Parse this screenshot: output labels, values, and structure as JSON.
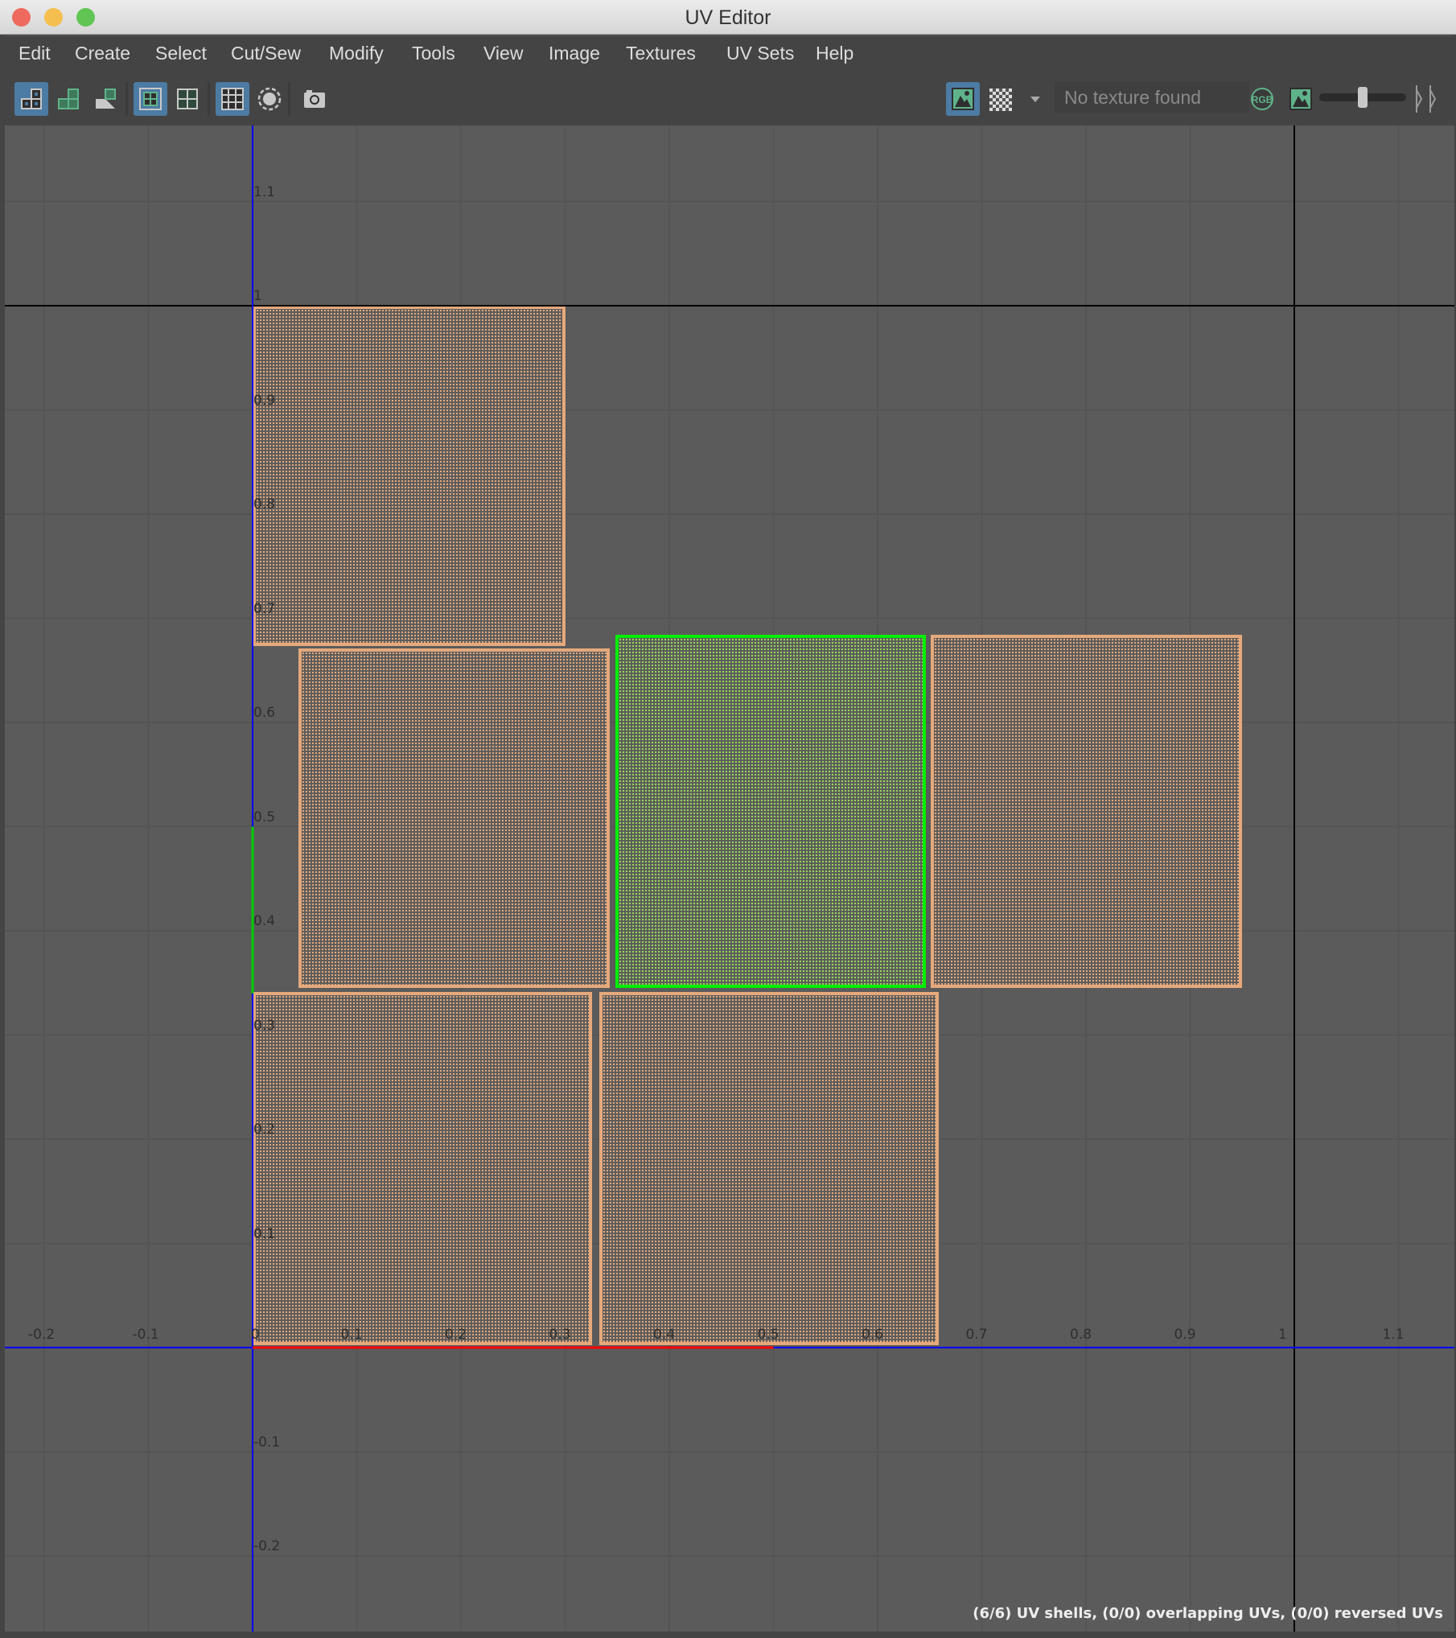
{
  "window": {
    "title": "UV Editor",
    "traffic_lights": [
      "#ee6a5e",
      "#f5bf4f",
      "#61c554"
    ]
  },
  "menu": [
    "Edit",
    "Create",
    "Select",
    "Cut/Sew",
    "Modify",
    "Tools",
    "View",
    "Image",
    "Textures",
    "UV Sets",
    "Help"
  ],
  "toolbar": {
    "left_icons": [
      {
        "name": "uv-shell-layout-icon",
        "active": true
      },
      {
        "name": "uv-shell-green-icon",
        "active": false
      },
      {
        "name": "uv-shell-partial-icon",
        "active": false
      },
      {
        "name": "wireframe-grid-icon",
        "active": true
      },
      {
        "name": "uv-grid-icon",
        "active": false
      },
      {
        "name": "dense-grid-icon",
        "active": true
      },
      {
        "name": "soft-select-circle-icon",
        "active": false
      },
      {
        "name": "camera-snapshot-icon",
        "active": false
      }
    ],
    "texture_field": "No texture found",
    "rgb_label": "RGB",
    "image_display_active": true,
    "slider_value": 0.5
  },
  "viewport": {
    "u_ticks": [
      "-0.2",
      "-0.1",
      "0",
      "0.1",
      "0.2",
      "0.3",
      "0.4",
      "0.5",
      "0.6",
      "0.7",
      "0.8",
      "0.9",
      "1",
      "1.1"
    ],
    "v_ticks": [
      "-0.2",
      "-0.1",
      "0",
      "0.1",
      "0.2",
      "0.3",
      "0.4",
      "0.5",
      "0.6",
      "0.7",
      "0.8",
      "0.9",
      "1",
      "1.1"
    ],
    "colors": {
      "grid": "#545454",
      "axis": "#0000ff",
      "u_highlight": "#ff0000",
      "v_highlight": "#00cc00",
      "unit_boundary": "#000000",
      "shell": "#e5a97c",
      "selected_shell": "#00ee00"
    },
    "shells": [
      {
        "u": [
          0.0,
          0.3
        ],
        "v": [
          0.673,
          1.0
        ],
        "selected": false
      },
      {
        "u": [
          0.044,
          0.343
        ],
        "v": [
          0.345,
          0.671
        ],
        "selected": false
      },
      {
        "u": [
          0.348,
          0.646
        ],
        "v": [
          0.345,
          0.684
        ],
        "selected": true
      },
      {
        "u": [
          0.651,
          0.95
        ],
        "v": [
          0.345,
          0.684
        ],
        "selected": false
      },
      {
        "u": [
          0.0,
          0.326
        ],
        "v": [
          0.002,
          0.341
        ],
        "selected": false
      },
      {
        "u": [
          0.333,
          0.659
        ],
        "v": [
          0.002,
          0.341
        ],
        "selected": false
      }
    ],
    "u_highlight_range": [
      0,
      0.5
    ],
    "v_highlight_range": [
      0.34,
      0.5
    ]
  },
  "status": "(6/6) UV shells, (0/0) overlapping UVs, (0/0) reversed UVs"
}
